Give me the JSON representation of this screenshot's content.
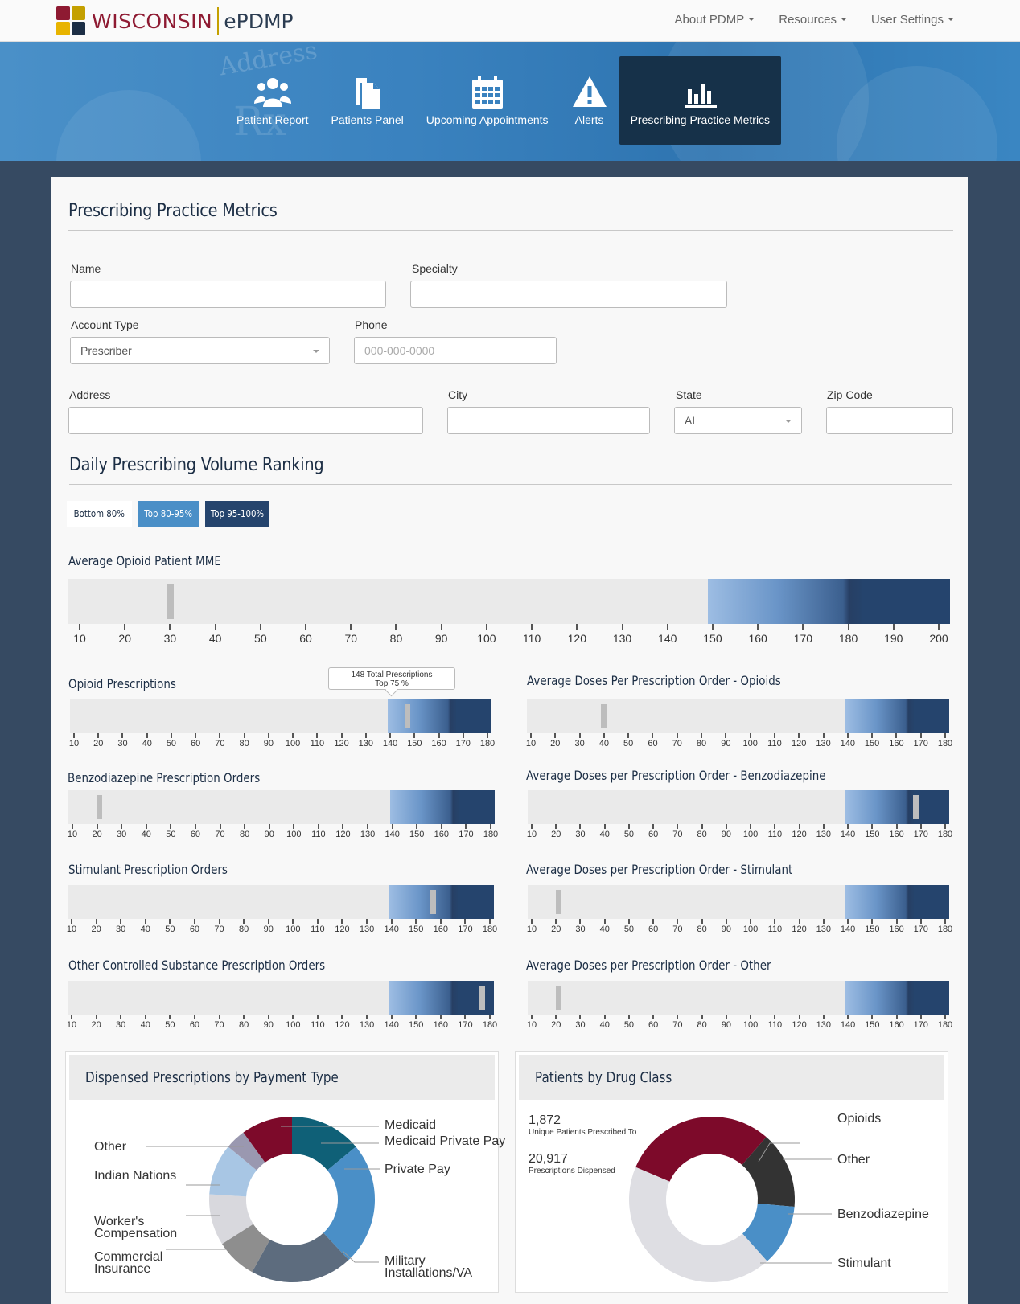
{
  "brand": {
    "state": "WISCONSIN",
    "product": "ePDMP"
  },
  "topnav": [
    {
      "label": "About PDMP"
    },
    {
      "label": "Resources"
    },
    {
      "label": "User Settings"
    }
  ],
  "tabs": [
    {
      "label": "Patient Report",
      "icon": "users-icon"
    },
    {
      "label": "Patients Panel",
      "icon": "documents-icon"
    },
    {
      "label": "Upcoming Appointments",
      "icon": "calendar-icon"
    },
    {
      "label": "Alerts",
      "icon": "warning-icon"
    },
    {
      "label": "Prescribing Practice Metrics",
      "icon": "bar-chart-icon",
      "active": true
    }
  ],
  "page": {
    "title": "Prescribing Practice Metrics"
  },
  "form": {
    "name_label": "Name",
    "name_value": "",
    "specialty_label": "Specialty",
    "specialty_value": "",
    "account_label": "Account Type",
    "account_value": "Prescriber",
    "phone_label": "Phone",
    "phone_placeholder": "000-000-0000",
    "address_label": "Address",
    "address_value": "",
    "city_label": "City",
    "city_value": "",
    "state_label": "State",
    "state_value": "AL",
    "zip_label": "Zip Code",
    "zip_value": ""
  },
  "ranking": {
    "title": "Daily Prescribing Volume Ranking",
    "legend": [
      "Bottom 80%",
      "Top 80-95%",
      "Top 95-100%"
    ]
  },
  "colors": {
    "navy": "#25446d",
    "accent_blue": "#4a8fc7",
    "maroon": "#7d0a2a",
    "light_track": "#eaeaea"
  },
  "metrics": {
    "big": {
      "label": "Average Opioid Patient MME",
      "ticks": [
        10,
        20,
        30,
        40,
        50,
        60,
        70,
        80,
        90,
        100,
        110,
        120,
        130,
        140,
        150,
        160,
        170,
        180,
        190,
        200
      ],
      "value": 30
    },
    "small_ticks": [
      10,
      20,
      30,
      40,
      50,
      60,
      70,
      80,
      90,
      100,
      110,
      120,
      130,
      140,
      150,
      160,
      170,
      180
    ],
    "items": [
      {
        "label": "Opioid Prescriptions",
        "value": 147
      },
      {
        "label": "Average Doses Per Prescription Order - Opioids",
        "value": 40
      },
      {
        "label": "Benzodiazepine Prescription Orders",
        "value": 21
      },
      {
        "label": "Average Doses per Prescription Order - Benzodiazepine",
        "value": 168
      },
      {
        "label": "Stimulant Prescription Orders",
        "value": 157
      },
      {
        "label": "Average Doses per Prescription Order - Stimulant",
        "value": 21
      },
      {
        "label": "Other Controlled Substance Prescription Orders",
        "value": 177
      },
      {
        "label": "Average Doses per Prescription Order - Other",
        "value": 21
      }
    ],
    "tooltip": {
      "line1": "148 Total Prescriptions",
      "line2": "Top 75 %"
    }
  },
  "payment_panel": {
    "title": "Dispensed Prescriptions by Payment Type"
  },
  "drug_panel": {
    "title": "Patients by Drug Class",
    "stat1_num": "1,872",
    "stat1_label": "Unique Patients Prescribed To",
    "stat2_num": "20,917",
    "stat2_label": "Prescriptions Dispensed"
  },
  "chart_data": [
    {
      "type": "pie",
      "title": "Dispensed Prescriptions by Payment Type",
      "categories": [
        "Medicaid Private Pay",
        "Private Pay",
        "Military Installations/VA",
        "Commercial Insurance",
        "Worker's Compensation",
        "Indian Nations",
        "Other",
        "Medicaid"
      ],
      "values": [
        14,
        24,
        20,
        8,
        10,
        10,
        4,
        10
      ],
      "colors": [
        "#0f6077",
        "#4a8fc7",
        "#5d6c7e",
        "#8e8e8e",
        "#d8d8dd",
        "#a8c6e4",
        "#9a98b0",
        "#7d0a2a"
      ]
    },
    {
      "type": "pie",
      "title": "Patients by Drug Class",
      "categories": [
        "Opioids",
        "Other",
        "Benzodiazepine",
        "Stimulant"
      ],
      "values": [
        30,
        15,
        12,
        43
      ],
      "colors": [
        "#7d0a2a",
        "#333333",
        "#4a8fc7",
        "#dedee3"
      ]
    }
  ]
}
